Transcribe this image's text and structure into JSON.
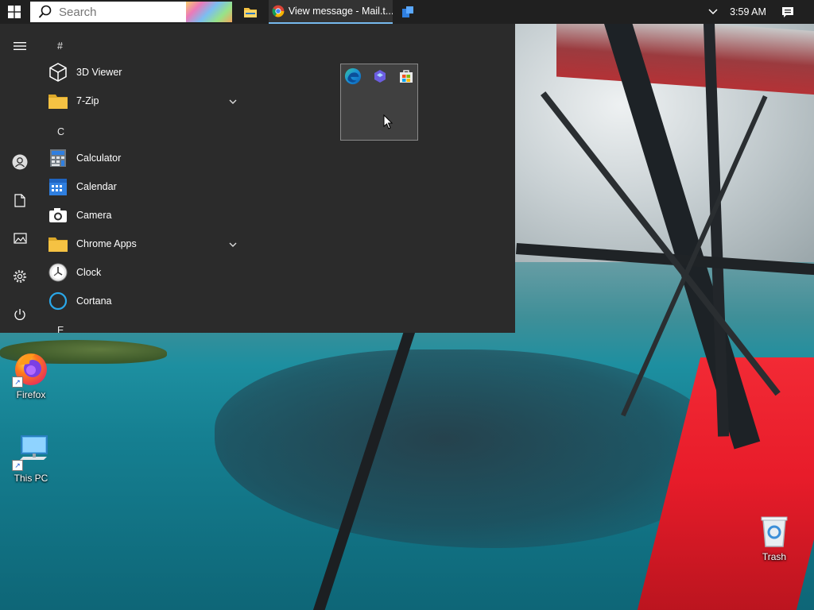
{
  "taskbar": {
    "search": {
      "placeholder": "Search"
    },
    "running": [
      {
        "name": "File Explorer"
      },
      {
        "name": "Google Chrome",
        "title": "View message - Mail.t..."
      }
    ],
    "clock": "3:59 AM"
  },
  "start_menu": {
    "rail_icons": [
      "hamburger-icon",
      "user-icon",
      "documents-icon",
      "pictures-icon",
      "settings-icon",
      "power-icon"
    ],
    "sections": [
      {
        "letter": "#",
        "apps": [
          {
            "name": "3D Viewer",
            "icon": "cube-icon"
          },
          {
            "name": "7-Zip",
            "icon": "folder-icon",
            "expandable": true
          }
        ]
      },
      {
        "letter": "C",
        "apps": [
          {
            "name": "Calculator",
            "icon": "calculator-icon"
          },
          {
            "name": "Calendar",
            "icon": "calendar-icon"
          },
          {
            "name": "Camera",
            "icon": "camera-icon"
          },
          {
            "name": "Chrome Apps",
            "icon": "folder-icon",
            "expandable": true
          },
          {
            "name": "Clock",
            "icon": "clock-icon"
          },
          {
            "name": "Cortana",
            "icon": "cortana-icon"
          }
        ]
      },
      {
        "letter": "E",
        "apps": []
      }
    ],
    "tile_group": [
      "edge-icon",
      "app-icon",
      "store-icon"
    ]
  },
  "desktop": {
    "icons": [
      {
        "label": "Firefox",
        "icon": "firefox-icon",
        "shortcut": true
      },
      {
        "label": "This PC",
        "icon": "computer-icon",
        "shortcut": true
      },
      {
        "label": "Trash",
        "icon": "recycle-bin-icon",
        "shortcut": false
      }
    ]
  },
  "colors": {
    "taskbar": "#202020",
    "start_menu": "#2b2b2b",
    "accent": "#76b9ed",
    "folder": "#f5c243",
    "calc_calendar": "#2f7fe0"
  }
}
